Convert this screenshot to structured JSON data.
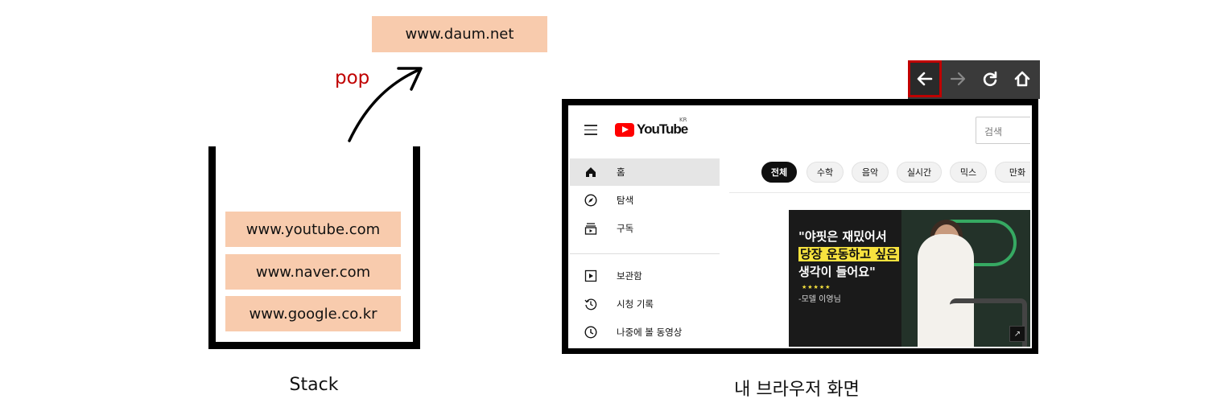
{
  "stack": {
    "popped_item": "www.daum.net",
    "pop_label": "pop",
    "items": [
      "www.youtube.com",
      "www.naver.com",
      "www.google.co.kr"
    ],
    "caption": "Stack"
  },
  "browser": {
    "caption": "내 브라우저 화면",
    "toolbar": {
      "back_icon": "arrow-left-icon",
      "forward_icon": "arrow-right-icon",
      "refresh_icon": "refresh-icon",
      "home_icon": "home-icon",
      "highlight_color": "#c00000"
    },
    "youtube": {
      "logo_text": "YouTube",
      "region": "KR",
      "search_placeholder": "검색",
      "sidebar": [
        {
          "label": "홈",
          "icon": "home-icon",
          "active": true
        },
        {
          "label": "탐색",
          "icon": "compass-icon",
          "active": false
        },
        {
          "label": "구독",
          "icon": "subscriptions-icon",
          "active": false
        },
        {
          "label": "보관함",
          "icon": "library-icon",
          "active": false
        },
        {
          "label": "시청 기록",
          "icon": "history-icon",
          "active": false
        },
        {
          "label": "나중에 볼 동영상",
          "icon": "clock-icon",
          "active": false
        }
      ],
      "chips": [
        "전체",
        "수학",
        "음악",
        "실시간",
        "믹스",
        "만화"
      ],
      "thumbnail": {
        "line1": "\"야핏은 재밌어서",
        "line2": "당장 운동하고 싶은",
        "line3": "생각이 들어요\"",
        "stars": "★★★★★",
        "sub": "-모델 이영님"
      }
    }
  }
}
